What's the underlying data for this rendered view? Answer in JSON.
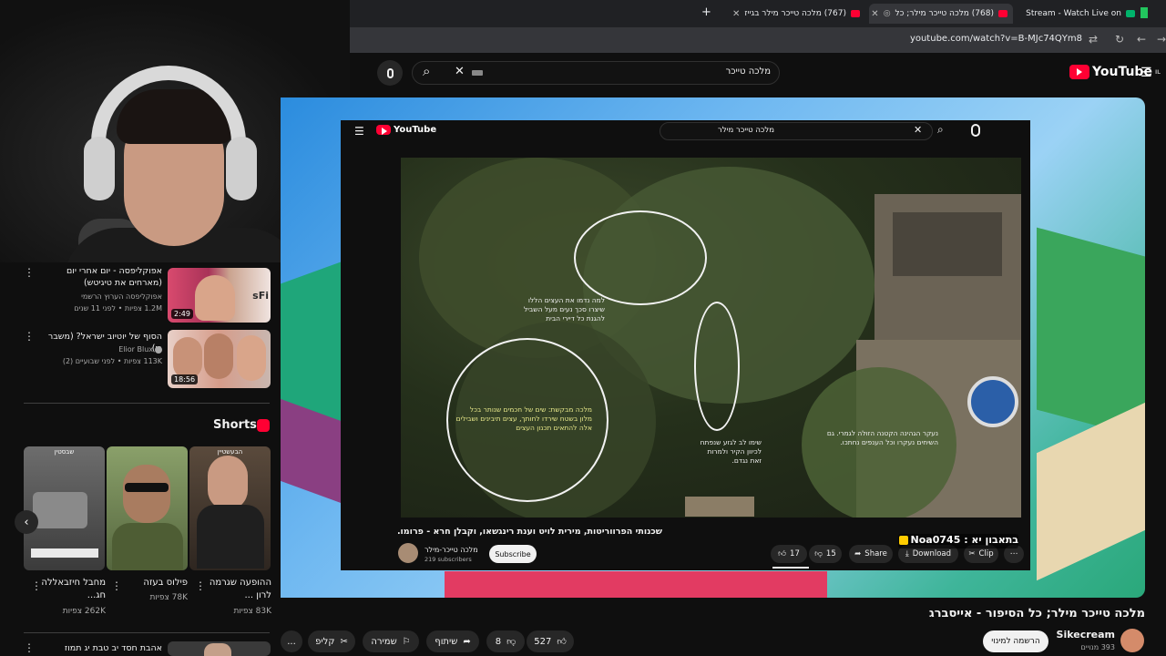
{
  "browser": {
    "tabs": [
      {
        "label": "LiorsLife Stream - Watch Live on"
      },
      {
        "label": "(768) מלכה טייכר מילר; כל"
      },
      {
        "label": "(767) מלכה טייכר מילר בגייז"
      }
    ],
    "new_tab_icon": "+",
    "url": "youtube.com/watch?v=B-MJc74QYm8"
  },
  "header": {
    "logo_text": "YouTube",
    "logo_superscript": "IL",
    "search_value": "מלכה טייכר"
  },
  "left_panel": {
    "recommendations": [
      {
        "title": "אפוקליפסה - יום אחרי יום (מארחים את טיגיטש)",
        "channel": "אפוקליפסה הערוץ הרשמי",
        "meta": "1.2M צפיות • לפני 11 שנים",
        "duration": "2:49",
        "thumb_text": "sFi"
      },
      {
        "title": "הסוף של יוטיוב ישראל? (משבר רי)",
        "channel": "Elior Blux",
        "meta": "113K צפיות • לפני שבועיים (2)",
        "duration": "18:56"
      }
    ],
    "shorts_header": "Shorts",
    "shorts": [
      {
        "title": "ההופעה שגרמה לרון ...",
        "views": "83K צפיות",
        "overlay": "הבעשטיין"
      },
      {
        "title": "פילוס בעזה",
        "views": "78K צפיות",
        "overlay": ""
      },
      {
        "title": "מחבל חיזבאללה חג...",
        "views": "262K צפיות",
        "overlay": "שבסטין"
      }
    ],
    "bottom_item": "אהבת חסד יב טבת יג תמוז"
  },
  "embedded": {
    "logo_text": "YouTube",
    "search_value": "מלכה טייכר מילר",
    "captions": {
      "c1": "למה נדמו את העצים הללו שיצרו סכך נעים מעל השביל להגנת כל דיירי הבית",
      "c2": "מלכה מבקשת: שים של חכמים שנותר בכל מלון בשטח שירדו לחותך, עצים תיבינים ושבילים אלה להתאים תכנון העצים",
      "c3": "שימו לב לגזע שנפתח לכיוון הקיר ולמרות זאת נגדם.",
      "c4": "נעקר הגהינה הקטנה הזולה לגמרי. גם השיחים נעקרו וכל הענפים נחתכו."
    },
    "title": "שכנותי הפרווריטות, מירית לויט וענת רינגשאו, וקבלן חרא - פרומו.",
    "channel_name": "מלכה טייכר-מילר",
    "subscribers": "219 subscribers",
    "subscribe_label": "Subscribe",
    "likes": "17",
    "dislikes": "15",
    "share_label": "Share",
    "download_label": "Download",
    "clip_label": "Clip"
  },
  "donation_overlay": "בתאבון יא : Noa0745",
  "main": {
    "title": "מלכה טייכר מילר; כל הסיפור - אייסברג",
    "channel": "Sikecream",
    "subscribers": "393 מנויים",
    "subscribe_label": "הרשמה למינוי",
    "likes": "527",
    "dislikes": "8",
    "share_label": "שיתוף",
    "save_label": "שמירה",
    "clip_label": "קליפ",
    "more_label": "..."
  },
  "colors": {
    "brand_red": "#ff0033",
    "background": "#0f0f0f",
    "pill_bg": "#272727"
  }
}
